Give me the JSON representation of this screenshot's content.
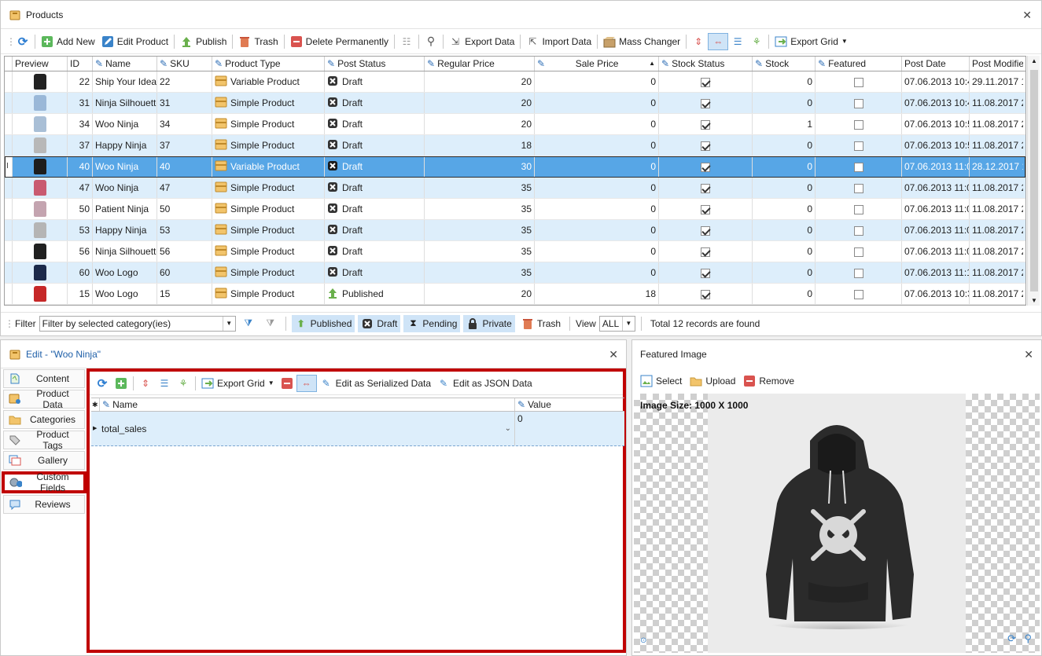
{
  "products_panel": {
    "title": "Products",
    "toolbar": {
      "add_new": "Add New",
      "edit_product": "Edit Product",
      "publish": "Publish",
      "trash": "Trash",
      "delete_permanently": "Delete Permanently",
      "export_data": "Export Data",
      "import_data": "Import Data",
      "mass_changer": "Mass Changer",
      "export_grid": "Export Grid"
    },
    "columns": [
      "Preview",
      "ID",
      "Name",
      "SKU",
      "Product Type",
      "Post Status",
      "Regular Price",
      "Sale Price",
      "Stock Status",
      "Stock",
      "Featured",
      "Post Date",
      "Post Modified"
    ],
    "rows": [
      {
        "thumb": "#222222",
        "id": "22",
        "name": "Ship Your Idea t",
        "sku": "22",
        "type": "Variable Product",
        "status": "Draft",
        "regular": "20",
        "sale": "0",
        "stock_status": true,
        "stock": "0",
        "featured": false,
        "post_date": "07.06.2013 10:4",
        "modified": "29.11.2017 1"
      },
      {
        "thumb": "#9ab8d8",
        "id": "31",
        "name": "Ninja Silhouette",
        "sku": "31",
        "type": "Simple Product",
        "status": "Draft",
        "regular": "20",
        "sale": "0",
        "stock_status": true,
        "stock": "0",
        "featured": false,
        "post_date": "07.06.2013 10:4",
        "modified": "11.08.2017 2"
      },
      {
        "thumb": "#a9bfd6",
        "id": "34",
        "name": "Woo Ninja",
        "sku": "34",
        "type": "Simple Product",
        "status": "Draft",
        "regular": "20",
        "sale": "0",
        "stock_status": true,
        "stock": "1",
        "featured": false,
        "post_date": "07.06.2013 10:5",
        "modified": "11.08.2017 2"
      },
      {
        "thumb": "#b8b8b8",
        "id": "37",
        "name": "Happy Ninja",
        "sku": "37",
        "type": "Simple Product",
        "status": "Draft",
        "regular": "18",
        "sale": "0",
        "stock_status": true,
        "stock": "0",
        "featured": false,
        "post_date": "07.06.2013 10:5",
        "modified": "11.08.2017 2"
      },
      {
        "thumb": "#1d1d1d",
        "id": "40",
        "name": "Woo Ninja",
        "sku": "40",
        "type": "Variable Product",
        "status": "Draft",
        "regular": "30",
        "sale": "0",
        "stock_status": true,
        "stock": "0",
        "featured": false,
        "post_date": "07.06.2013 11:0",
        "modified": "28.12.2017 1",
        "selected": true
      },
      {
        "thumb": "#c95a70",
        "id": "47",
        "name": "Woo Ninja",
        "sku": "47",
        "type": "Simple Product",
        "status": "Draft",
        "regular": "35",
        "sale": "0",
        "stock_status": true,
        "stock": "0",
        "featured": false,
        "post_date": "07.06.2013 11:0",
        "modified": "11.08.2017 2"
      },
      {
        "thumb": "#c4a4b0",
        "id": "50",
        "name": "Patient Ninja",
        "sku": "50",
        "type": "Simple Product",
        "status": "Draft",
        "regular": "35",
        "sale": "0",
        "stock_status": true,
        "stock": "0",
        "featured": false,
        "post_date": "07.06.2013 11:0",
        "modified": "11.08.2017 2"
      },
      {
        "thumb": "#b5b5b5",
        "id": "53",
        "name": "Happy Ninja",
        "sku": "53",
        "type": "Simple Product",
        "status": "Draft",
        "regular": "35",
        "sale": "0",
        "stock_status": true,
        "stock": "0",
        "featured": false,
        "post_date": "07.06.2013 11:0",
        "modified": "11.08.2017 2"
      },
      {
        "thumb": "#202020",
        "id": "56",
        "name": "Ninja Silhouette",
        "sku": "56",
        "type": "Simple Product",
        "status": "Draft",
        "regular": "35",
        "sale": "0",
        "stock_status": true,
        "stock": "0",
        "featured": false,
        "post_date": "07.06.2013 11:0",
        "modified": "11.08.2017 2"
      },
      {
        "thumb": "#1c2a4a",
        "id": "60",
        "name": "Woo Logo",
        "sku": "60",
        "type": "Simple Product",
        "status": "Draft",
        "regular": "35",
        "sale": "0",
        "stock_status": true,
        "stock": "0",
        "featured": false,
        "post_date": "07.06.2013 11:1",
        "modified": "11.08.2017 2"
      },
      {
        "thumb": "#c62828",
        "id": "15",
        "name": "Woo Logo",
        "sku": "15",
        "type": "Simple Product",
        "status": "Published",
        "regular": "20",
        "sale": "18",
        "stock_status": true,
        "stock": "0",
        "featured": false,
        "post_date": "07.06.2013 10:3",
        "modified": "11.08.2017 2"
      }
    ],
    "filter": {
      "label": "Filter",
      "placeholder": "Filter by selected category(ies)",
      "published": "Published",
      "draft": "Draft",
      "pending": "Pending",
      "private": "Private",
      "trash": "Trash",
      "view_label": "View",
      "view_value": "ALL",
      "total": "Total 12 records are found"
    }
  },
  "edit_panel": {
    "title": "Edit - \"Woo Ninja\"",
    "tabs": [
      "Content",
      "Product Data",
      "Categories",
      "Product Tags",
      "Gallery",
      "Custom Fields",
      "Reviews"
    ],
    "active_tab": "Custom Fields",
    "toolbar": {
      "export_grid": "Export Grid",
      "edit_serialized": "Edit as Serialized Data",
      "edit_json": "Edit as JSON Data"
    },
    "columns": {
      "name": "Name",
      "value": "Value"
    },
    "row": {
      "name": "total_sales",
      "value": "0"
    }
  },
  "image_panel": {
    "title": "Featured Image",
    "select": "Select",
    "upload": "Upload",
    "remove": "Remove",
    "image_size": "Image Size: 1000 X 1000"
  },
  "colors": {
    "accent_blue": "#57a6e6",
    "alt_row": "#ddeefb",
    "highlight_red": "#c00000"
  }
}
